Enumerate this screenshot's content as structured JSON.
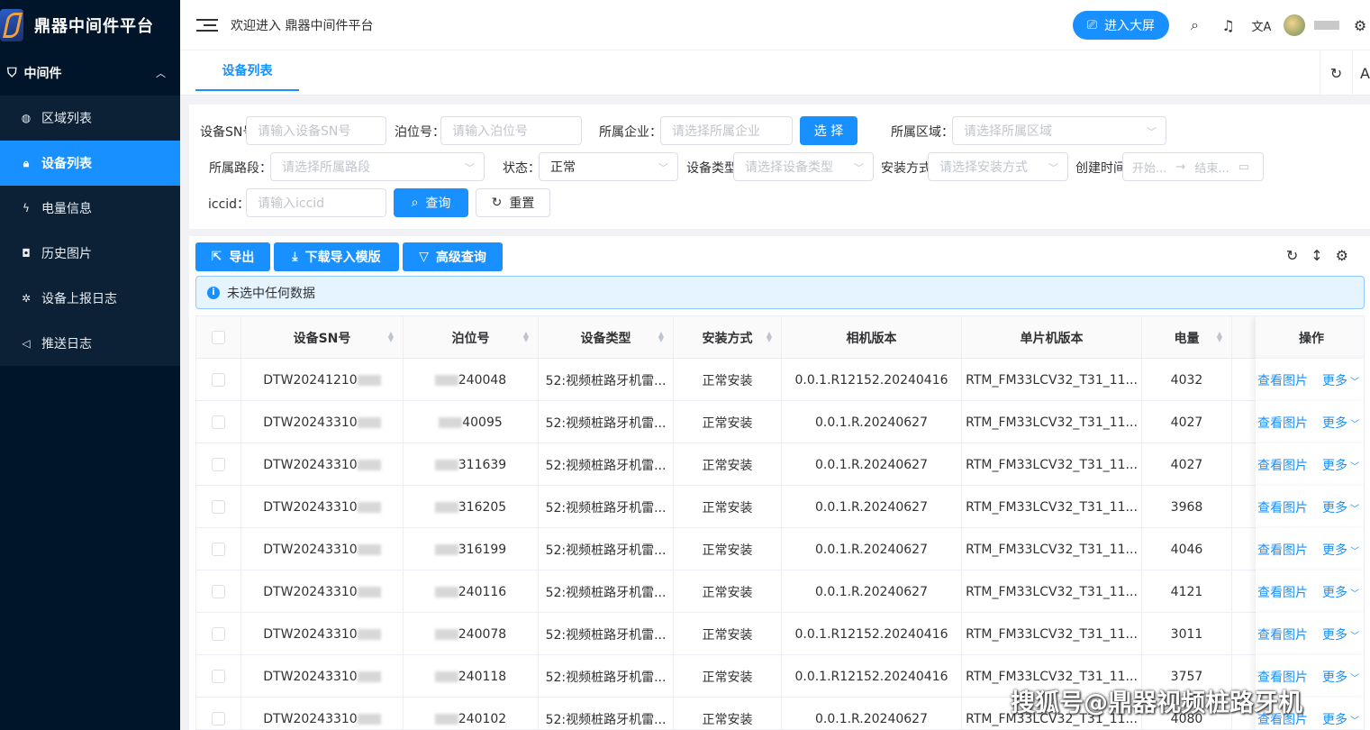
{
  "app": {
    "title": "鼎器中间件平台",
    "welcome": "欢迎进入 鼎器中间件平台"
  },
  "header": {
    "screen_btn": "进入大屏"
  },
  "sidebar": {
    "group": "中间件",
    "items": [
      {
        "label": "区域列表",
        "icon": "globe-icon"
      },
      {
        "label": "设备列表",
        "icon": "lock-icon",
        "active": true
      },
      {
        "label": "电量信息",
        "icon": "lightning-icon"
      },
      {
        "label": "历史图片",
        "icon": "camera-icon"
      },
      {
        "label": "设备上报日志",
        "icon": "bug-icon"
      },
      {
        "label": "推送日志",
        "icon": "speaker-icon"
      }
    ]
  },
  "tabs": {
    "active": "设备列表"
  },
  "filters": {
    "sn_label": "设备SN号",
    "sn_placeholder": "请输入设备SN号",
    "berth_label": "泊位号：",
    "berth_placeholder": "请输入泊位号",
    "company_label": "所属企业：",
    "company_placeholder": "请选择所属企业",
    "select_btn": "选 择",
    "area_label": "所属区域：",
    "area_placeholder": "请选择所属区域",
    "road_label": "所属路段：",
    "road_placeholder": "请选择所属路段",
    "status_label": "状态：",
    "status_value": "正常",
    "type_label": "设备类型",
    "type_placeholder": "请选择设备类型",
    "install_label": "安装方式",
    "install_placeholder": "请选择安装方式",
    "created_label": "创建时间",
    "start_placeholder": "开始...",
    "end_placeholder": "结束...",
    "iccid_label": "iccid：",
    "iccid_placeholder": "请输入iccid",
    "query_btn": "查询",
    "reset_btn": "重置"
  },
  "toolbar": {
    "export": "导出",
    "download": "下载导入模版",
    "advanced": "高级查询"
  },
  "alert": "未选中任何数据",
  "table": {
    "headers": [
      "设备SN号",
      "泊位号",
      "设备类型",
      "安装方式",
      "相机版本",
      "单片机版本",
      "电量",
      "操作"
    ],
    "view_link": "查看图片",
    "more_link": "更多",
    "rows": [
      {
        "sn": "DTW20241210",
        "berth": "240048",
        "type": "52:视频桩路牙机雷...",
        "install": "正常安装",
        "camera": "0.0.1.R12152.20240416",
        "mcu": "RTM_FM33LCV32_T31_11...",
        "power": "4032"
      },
      {
        "sn": "DTW20243310",
        "berth": "40095",
        "type": "52:视频桩路牙机雷...",
        "install": "正常安装",
        "camera": "0.0.1.R.20240627",
        "mcu": "RTM_FM33LCV32_T31_11...",
        "power": "4027"
      },
      {
        "sn": "DTW20243310",
        "berth": "311639",
        "type": "52:视频桩路牙机雷...",
        "install": "正常安装",
        "camera": "0.0.1.R.20240627",
        "mcu": "RTM_FM33LCV32_T31_11...",
        "power": "4027"
      },
      {
        "sn": "DTW20243310",
        "berth": "316205",
        "type": "52:视频桩路牙机雷...",
        "install": "正常安装",
        "camera": "0.0.1.R.20240627",
        "mcu": "RTM_FM33LCV32_T31_11...",
        "power": "3968"
      },
      {
        "sn": "DTW20243310",
        "berth": "316199",
        "type": "52:视频桩路牙机雷...",
        "install": "正常安装",
        "camera": "0.0.1.R.20240627",
        "mcu": "RTM_FM33LCV32_T31_11...",
        "power": "4046"
      },
      {
        "sn": "DTW20243310",
        "berth": "240116",
        "type": "52:视频桩路牙机雷...",
        "install": "正常安装",
        "camera": "0.0.1.R.20240627",
        "mcu": "RTM_FM33LCV32_T31_11...",
        "power": "4121"
      },
      {
        "sn": "DTW20243310",
        "berth": "240078",
        "type": "52:视频桩路牙机雷...",
        "install": "正常安装",
        "camera": "0.0.1.R12152.20240416",
        "mcu": "RTM_FM33LCV32_T31_11...",
        "power": "3011"
      },
      {
        "sn": "DTW20243310",
        "berth": "240118",
        "type": "52:视频桩路牙机雷...",
        "install": "正常安装",
        "camera": "0.0.1.R12152.20240416",
        "mcu": "RTM_FM33LCV32_T31_11...",
        "power": "3757"
      },
      {
        "sn": "DTW20243310",
        "berth": "240102",
        "type": "52:视频桩路牙机雷...",
        "install": "正常安装",
        "camera": "0.0.1.R.20240627",
        "mcu": "RTM_FM33LCV32_T31_11...",
        "power": "4080"
      }
    ]
  },
  "watermark": "搜狐号@鼎器视频桩路牙机",
  "colors": {
    "primary": "#1890ff",
    "sidebar": "#001529"
  }
}
